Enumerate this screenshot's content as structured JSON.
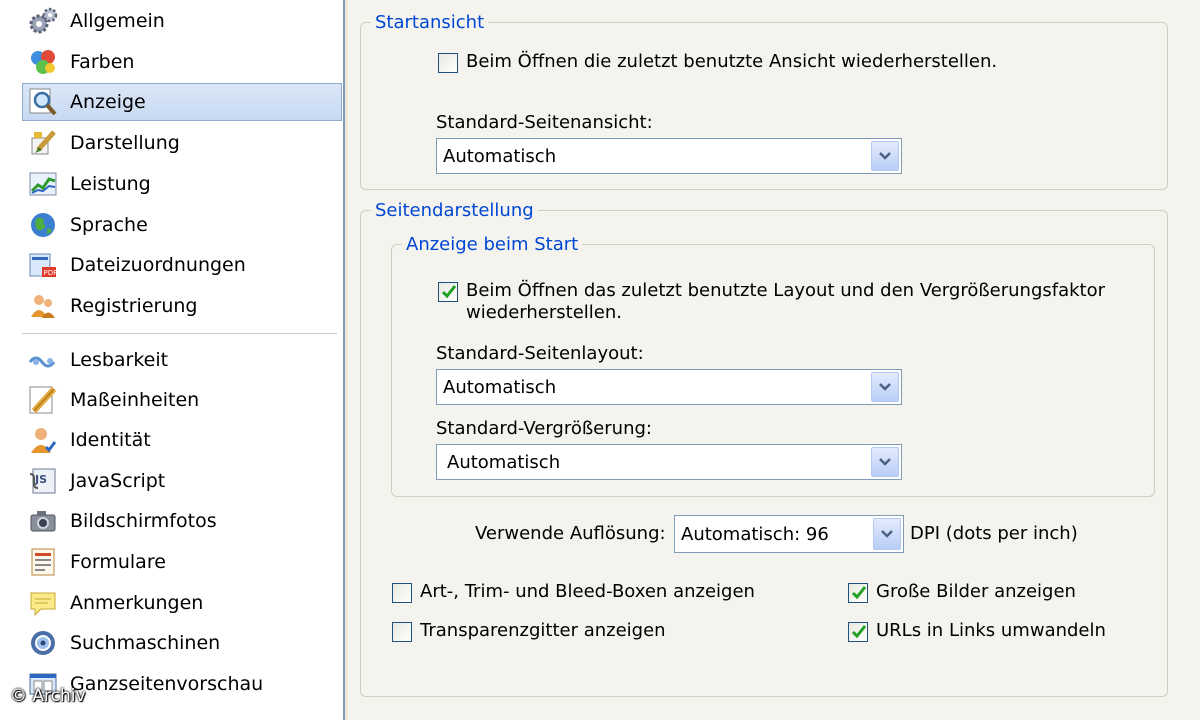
{
  "sidebar": {
    "items": [
      {
        "label": "Allgemein",
        "icon": "gears-icon"
      },
      {
        "label": "Farben",
        "icon": "color-balls-icon"
      },
      {
        "label": "Anzeige",
        "icon": "magnifier-icon",
        "selected": true
      },
      {
        "label": "Darstellung",
        "icon": "paint-brush-icon"
      },
      {
        "label": "Leistung",
        "icon": "performance-chart-icon"
      },
      {
        "label": "Sprache",
        "icon": "globe-icon"
      },
      {
        "label": "Dateizuordnungen",
        "icon": "file-association-icon"
      },
      {
        "label": "Registrierung",
        "icon": "users-icon"
      },
      {
        "label": "Lesbarkeit",
        "icon": "readability-icon"
      },
      {
        "label": "Maßeinheiten",
        "icon": "ruler-icon"
      },
      {
        "label": "Identität",
        "icon": "identity-user-icon"
      },
      {
        "label": "JavaScript",
        "icon": "javascript-icon"
      },
      {
        "label": "Bildschirmfotos",
        "icon": "camera-icon"
      },
      {
        "label": "Formulare",
        "icon": "form-icon"
      },
      {
        "label": "Anmerkungen",
        "icon": "sticky-note-icon"
      },
      {
        "label": "Suchmaschinen",
        "icon": "search-engine-icon"
      },
      {
        "label": "Ganzseitenvorschau",
        "icon": "page-preview-icon"
      }
    ]
  },
  "watermark": "© Archiv",
  "startansicht": {
    "legend": "Startansicht",
    "restore_view": {
      "label": "Beim Öffnen die zuletzt benutzte Ansicht wiederherstellen.",
      "checked": false
    },
    "default_view_label": "Standard-Seitenansicht:",
    "default_view_value": "Automatisch"
  },
  "seitendarstellung": {
    "legend": "Seitendarstellung",
    "anzeige_start": {
      "legend": "Anzeige beim Start",
      "restore_layout": {
        "line1": "Beim Öffnen das zuletzt benutzte Layout und den Vergrößerungsfaktor",
        "line2": "wiederherstellen.",
        "checked": true
      },
      "layout_label": "Standard-Seitenlayout:",
      "layout_value": "Automatisch",
      "zoom_label": "Standard-Vergrößerung:",
      "zoom_value": "Automatisch"
    },
    "resolution_label": "Verwende Auflösung:",
    "resolution_value": "Automatisch: 96",
    "resolution_unit": "DPI (dots per inch)",
    "options": [
      {
        "label": "Art-, Trim- und Bleed-Boxen anzeigen",
        "checked": false
      },
      {
        "label": "Große Bilder anzeigen",
        "checked": true
      },
      {
        "label": "Transparenzgitter anzeigen",
        "checked": false
      },
      {
        "label": "URLs in Links umwandeln",
        "checked": true
      }
    ]
  },
  "colors": {
    "legend_blue": "#0046d5",
    "selection": "#c7d9f2",
    "check_green": "#21a121"
  }
}
